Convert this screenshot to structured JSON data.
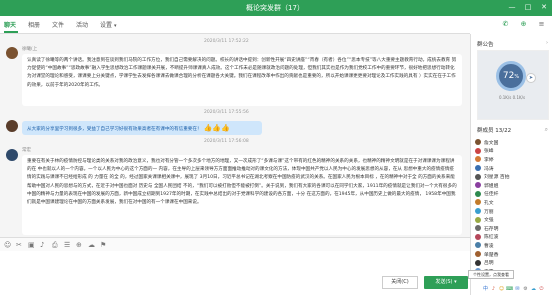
{
  "app": {
    "title": "概论突发群（17）"
  },
  "window": {
    "minimize": "—",
    "maximize": "□",
    "close": "✕"
  },
  "tabs": [
    {
      "label": "聊天"
    },
    {
      "label": "相册"
    },
    {
      "label": "文件"
    },
    {
      "label": "活动"
    },
    {
      "label": "设置",
      "arrow": "▾"
    }
  ],
  "messages": [
    {
      "time": "2020/3/11 17:52:22",
      "sender": "徐曦(上",
      "text": "认真读了徐曦等的两个讲话。我注意到在谈到我们马院的工作方位，我们自己需要解决的问题。校长的讲话中提到：创新性开展“四史讲座”“宵春（有者）各位”“思本专技”等八大重要主题教育行动，成统去教育 努力促使的“中国故事”“思政故事”融入学生思想政治工作课题课关开展，不断提升师课课真人成效。这个工作未必是随课就政治问题的处理，但我们其实也是作为我们党校工作中的重要环节，很好地把思想行动转化为对课堂的理论和感受，课课要上分关键点，学课学生去发挥各课课去做课合理的分析在课题各大关键。我们在课程改革中作出的贡献也是重要的，所以开始课课更更要对理论及工作实践的具有 ）实实在在于工作的效果，以前于年的2020年的工作。"
    },
    {
      "time": "2020/3/11 17:55:56",
      "sender": "",
      "text": "从大家的分享里学习到很多，受益了自己学习好很有效果高者在有课中的有信重要在！",
      "emoji": "👍👍👍"
    },
    {
      "time": "2020/3/11 17:56:08",
      "sender": "常宏",
      "text": "重要在有关于林的疫情防控与理论类的关系对我的政治意义，我也对有分管一个多次多个地方的地理，又一次成形了“多课与课”这个带有的红色的精神的关系的关系，也精神的精神文明就是在于对课课课为课程讲的在 中也就以人的一个内容。一个以人民为中心的这个方面的一 内容，在主导的上层来领导方方面面推动推动对的课文化的方法，体现中国共产党以人民为中心的发展思想的从容，在从 思想中重大的疫情疫情疫情的实践与课课不已经给形成 的 力量在 的全 的，经过国家关课课相关课中，展现了 3月10日，习近平总书记在湖北考察在中国防疫的武汉的关系。在国家人民为根本目标 ，在的精神中对于全 的方面的关系来能帮助中国对人民的思想与的方式，在近于对中国也面对 历史与 全国人民团结 不的，“我们可以被打败但不能被打倒”。关于说到，我们有大家的各课可以在同学们大家，1911年的疫情就是让我们对一个大有很多的中国的精神与力量的表现在中国的发展的方面，新中国成立初期到1927年的时期，在实践中总结出的对于党课科学的建设的各方面，十分 在这方面的，在1945年，从中国历史上做的最大的疫情， 1958年中国我们就是中国课建理论在中国的方面关系发展，我们在对中国的有一个课课在中国来说。"
    }
  ],
  "toolbar_icons": [
    "☺",
    "✂",
    "▣",
    "♪",
    "⎙",
    "☰",
    "⊕",
    "☁",
    "⚑"
  ],
  "buttons": {
    "close": "关闭(C)",
    "send": "发送(S)",
    "send_arrow": "▾"
  },
  "tooltip": "个性设置，点我查看",
  "notice": {
    "title": "群公告",
    "more": "›",
    "gauge_value": "72",
    "gauge_unit": "%",
    "gauge_label": "0.1K/s  0.1K/s"
  },
  "members": {
    "title": "群成员 13/22",
    "search": "⌕",
    "list": [
      {
        "name": "詹文国",
        "color": "#7a5230"
      },
      {
        "name": "张峰",
        "color": "#c44"
      },
      {
        "name": "李婷",
        "color": "#d47a36"
      },
      {
        "name": "冯涛",
        "color": "#3a6fb0"
      },
      {
        "name": "刘星源 百拍",
        "color": "#555"
      },
      {
        "name": "郭姐姐",
        "color": "#8a3fa0"
      },
      {
        "name": "任佳纤",
        "color": "#2e8a4f"
      },
      {
        "name": "孔文",
        "color": "#c27b2a"
      },
      {
        "name": "万丽",
        "color": "#3a9fcf"
      },
      {
        "name": "文强",
        "color": "#9a4"
      },
      {
        "name": "石存明",
        "color": "#6b6b6b"
      },
      {
        "name": "陈红波",
        "color": "#b5475a"
      },
      {
        "name": "曹凌",
        "color": "#4a7fa8"
      },
      {
        "name": "单楚香",
        "color": "#a06030"
      },
      {
        "name": "吕明",
        "color": "#333"
      },
      {
        "name": "王雪",
        "color": "#6a9ad0"
      }
    ]
  },
  "taskbar": [
    "中",
    "♪",
    "☺",
    "⌨",
    "✉",
    "⚙",
    "☁",
    "⏻"
  ]
}
